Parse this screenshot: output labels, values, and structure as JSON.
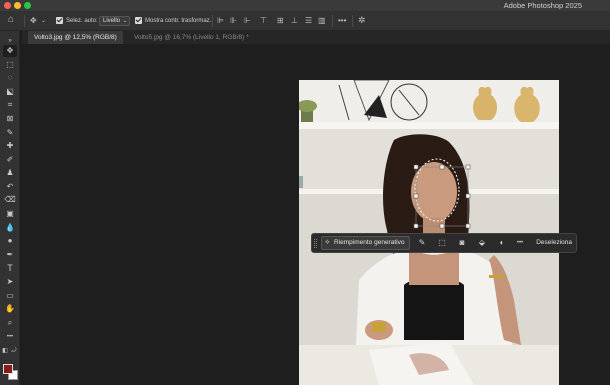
{
  "app": {
    "title": "Adobe Photoshop 2025"
  },
  "options_bar": {
    "auto_select_label": "Selez. auto:",
    "auto_select_value": "Livello",
    "show_transform_label": "Mostra contr. trasformaz."
  },
  "tabs": [
    {
      "label": "Volto3.jpg @ 12,5% (RGB/8)",
      "active": true
    },
    {
      "label": "Volto5.jpg @ 16,7% (Livello 1, RGB/8) *",
      "active": false
    }
  ],
  "context_bar": {
    "generative_fill_label": "Riempimento generativo",
    "deselect_label": "Deseleziona"
  },
  "colors": {
    "foreground": "#8b1a1a",
    "background": "#ffffff",
    "ui_dark": "#1e1e1e",
    "panel": "#323232"
  }
}
